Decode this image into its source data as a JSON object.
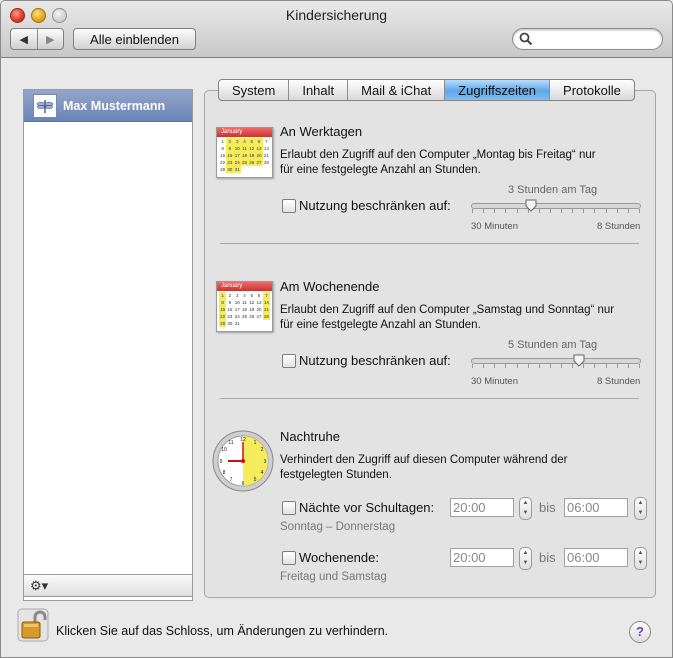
{
  "window": {
    "title": "Kindersicherung"
  },
  "toolbar": {
    "back_icon": "◀",
    "forward_icon": "▶",
    "show_all_label": "Alle einblenden",
    "search_placeholder": ""
  },
  "sidebar": {
    "users": [
      {
        "name": "Max Mustermann",
        "selected": true
      }
    ],
    "action_icon": "⚙▾"
  },
  "tabs": [
    {
      "label": "System",
      "active": false
    },
    {
      "label": "Inhalt",
      "active": false
    },
    {
      "label": "Mail & iChat",
      "active": false
    },
    {
      "label": "Zugriffszeiten",
      "active": true
    },
    {
      "label": "Protokolle",
      "active": false
    }
  ],
  "weekdays": {
    "title": "An Werktagen",
    "description_line1": "Erlaubt den Zugriff auf den Computer „Montag bis Freitag“ nur",
    "description_line2": "für eine festgelegte Anzahl an Stunden.",
    "checkbox_label": "Nutzung beschränken auf:",
    "checked": false,
    "slider_value_label": "3 Stunden am Tag",
    "slider_min_label": "30 Minuten",
    "slider_max_label": "8 Stunden",
    "slider_fraction": 0.36,
    "calendar_month": "January"
  },
  "weekend": {
    "title": "Am Wochenende",
    "description_line1": "Erlaubt den Zugriff auf den Computer „Samstag und Sonntag“ nur",
    "description_line2": "für eine festgelegte Anzahl an Stunden.",
    "checkbox_label": "Nutzung beschränken auf:",
    "checked": false,
    "slider_value_label": "5 Stunden am Tag",
    "slider_min_label": "30 Minuten",
    "slider_max_label": "8 Stunden",
    "slider_fraction": 0.64,
    "calendar_month": "January"
  },
  "bedtime": {
    "title": "Nachtruhe",
    "description_line1": "Verhindert den Zugriff auf diesen Computer während der",
    "description_line2": "festgelegten Stunden.",
    "school_nights": {
      "label": "Nächte vor Schultagen:",
      "checked": false,
      "from": "20:00",
      "to": "06:00",
      "note": "Sonntag – Donnerstag"
    },
    "weekend": {
      "label": "Wochenende:",
      "checked": false,
      "from": "20:00",
      "to": "06:00",
      "note": "Freitag und Samstag"
    },
    "bis_label": "bis"
  },
  "footer": {
    "lock_text": "Klicken Sie auf das Schloss, um Änderungen zu verhindern.",
    "help_label": "?"
  },
  "colors": {
    "accent_tab": "#5ea7ea",
    "selected_user": "#6a84b8",
    "calendar_header": "#c83232",
    "calendar_highlight": "#f4ec5c",
    "help_glyph": "#6a3fb0"
  }
}
